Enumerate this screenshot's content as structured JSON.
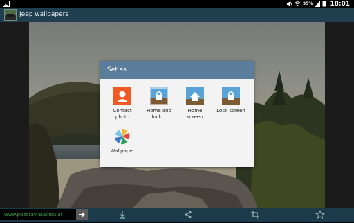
{
  "status_bar": {
    "battery_percent": "95%",
    "time": "18:01",
    "icons": [
      "image-notification-icon",
      "mute-icon",
      "wifi-icon",
      "signal-icon",
      "battery-icon"
    ]
  },
  "action_bar": {
    "title": "Jeep wallpapers",
    "icon": "app-thumbnail-icon"
  },
  "dialog": {
    "title": "Set as",
    "options": [
      {
        "label_line1": "Contact",
        "label_line2": "photo",
        "icon": "contact-photo-icon"
      },
      {
        "label_line1": "Home and",
        "label_line2": "lock...",
        "icon": "home-and-lock-icon"
      },
      {
        "label_line1": "Home",
        "label_line2": "screen",
        "icon": "home-screen-icon"
      },
      {
        "label_line1": "Lock screen",
        "label_line2": "",
        "icon": "lock-screen-icon"
      },
      {
        "label_line1": "Wallpaper",
        "label_line2": "",
        "icon": "wallpaper-icon"
      }
    ]
  },
  "bottom_bar": {
    "site_text": "www.pozdravlatalnoa.at",
    "icons": [
      "arrow-right-icon",
      "download-icon",
      "share-icon",
      "crop-icon",
      "star-icon"
    ]
  }
}
